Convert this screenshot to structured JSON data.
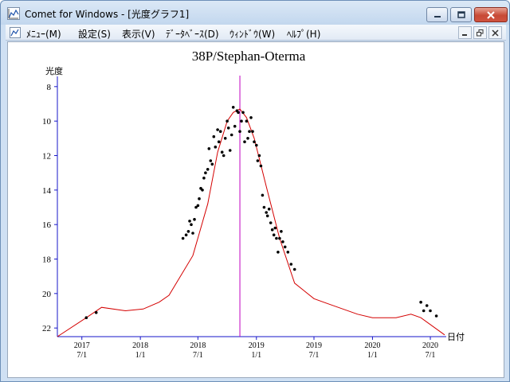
{
  "window": {
    "title": "Comet for Windows - [光度グラフ1]"
  },
  "titlebar_buttons": {
    "minimize_icon": "minimize-icon",
    "maximize_icon": "maximize-icon",
    "close_icon": "close-icon"
  },
  "menu": {
    "items": [
      "ﾒﾆｭｰ(M)",
      "設定(S)",
      "表示(V)",
      "ﾃﾞｰﾀﾍﾞｰｽ(D)",
      "ｳｨﾝﾄﾞｳ(W)",
      "ﾍﾙﾌﾟ(H)"
    ]
  },
  "colors": {
    "axis": "#1515c8",
    "curve": "#d40000",
    "marker": "#c000c0",
    "points": "#000000",
    "close_button": "#c74a36"
  },
  "chart_data": {
    "type": "scatter",
    "title": "38P/Stephan-Oterma",
    "ylabel": "光度",
    "xlabel": "日付",
    "y_inverted": true,
    "ylim": [
      22.5,
      7.5
    ],
    "yticks": [
      8,
      10,
      12,
      14,
      16,
      18,
      20,
      22
    ],
    "xlim": [
      "2017-04-15",
      "2020-08-15"
    ],
    "xticks": [
      {
        "date": "2017-07-01",
        "year": "2017",
        "md": "7/1"
      },
      {
        "date": "2018-01-01",
        "year": "2018",
        "md": "1/1"
      },
      {
        "date": "2018-07-01",
        "year": "2018",
        "md": "7/1"
      },
      {
        "date": "2019-01-01",
        "year": "2019",
        "md": "1/1"
      },
      {
        "date": "2019-07-01",
        "year": "2019",
        "md": "7/1"
      },
      {
        "date": "2020-01-01",
        "year": "2020",
        "md": "1/1"
      },
      {
        "date": "2020-07-01",
        "year": "2020",
        "md": "7/1"
      }
    ],
    "perihelion_marker": "2018-11-10",
    "series": [
      {
        "type": "line",
        "x": [
          "2017-04-15",
          "2017-07-15",
          "2017-09-01",
          "2017-11-15",
          "2018-01-10",
          "2018-03-01",
          "2018-04-01",
          "2018-06-15",
          "2018-08-01",
          "2018-09-01",
          "2018-10-01",
          "2018-10-20",
          "2018-11-10",
          "2018-12-01",
          "2018-12-25",
          "2019-02-01",
          "2019-03-15",
          "2019-05-01",
          "2019-07-01",
          "2019-08-15",
          "2019-11-15",
          "2020-01-01",
          "2020-03-15",
          "2020-05-01",
          "2020-06-01",
          "2020-08-15"
        ],
        "y": [
          22.5,
          21.4,
          20.8,
          21.0,
          20.9,
          20.5,
          20.1,
          17.8,
          14.8,
          11.8,
          10.0,
          9.5,
          9.3,
          9.8,
          11.0,
          13.8,
          16.8,
          19.4,
          20.3,
          20.6,
          21.2,
          21.4,
          21.4,
          21.2,
          21.4,
          22.4
        ]
      },
      {
        "type": "scatter",
        "x": [
          "2017-07-15",
          "2017-08-15",
          "2018-05-15",
          "2018-05-25",
          "2018-06-01",
          "2018-06-05",
          "2018-06-10",
          "2018-06-15",
          "2018-06-20",
          "2018-06-25",
          "2018-07-01",
          "2018-07-05",
          "2018-07-10",
          "2018-07-15",
          "2018-07-20",
          "2018-07-25",
          "2018-08-01",
          "2018-08-05",
          "2018-08-10",
          "2018-08-15",
          "2018-08-20",
          "2018-08-25",
          "2018-09-01",
          "2018-09-05",
          "2018-09-10",
          "2018-09-15",
          "2018-09-20",
          "2018-09-25",
          "2018-10-01",
          "2018-10-05",
          "2018-10-10",
          "2018-10-15",
          "2018-10-20",
          "2018-10-25",
          "2018-11-01",
          "2018-11-05",
          "2018-11-10",
          "2018-11-15",
          "2018-11-20",
          "2018-11-25",
          "2018-12-01",
          "2018-12-05",
          "2018-12-10",
          "2018-12-15",
          "2018-12-20",
          "2018-12-25",
          "2019-01-01",
          "2019-01-05",
          "2019-01-10",
          "2019-01-15",
          "2019-01-20",
          "2019-01-25",
          "2019-02-01",
          "2019-02-05",
          "2019-02-10",
          "2019-02-15",
          "2019-02-20",
          "2019-02-25",
          "2019-03-01",
          "2019-03-05",
          "2019-03-10",
          "2019-03-15",
          "2019-03-20",
          "2019-03-25",
          "2019-04-01",
          "2019-04-10",
          "2019-04-20",
          "2019-05-01",
          "2020-06-01",
          "2020-06-10",
          "2020-06-20",
          "2020-07-01",
          "2020-07-20"
        ],
        "y": [
          21.4,
          21.1,
          16.8,
          16.6,
          16.4,
          15.8,
          16.0,
          16.5,
          15.7,
          15.0,
          14.9,
          14.5,
          13.9,
          14.0,
          13.3,
          13.0,
          12.8,
          11.6,
          12.3,
          12.5,
          10.9,
          11.5,
          10.5,
          11.2,
          10.6,
          11.8,
          12.0,
          11.0,
          10.0,
          10.4,
          11.7,
          10.8,
          9.2,
          10.3,
          9.4,
          9.5,
          10.6,
          10.0,
          9.5,
          11.2,
          10.0,
          11.0,
          10.6,
          9.8,
          10.6,
          11.2,
          11.4,
          12.3,
          12.0,
          12.6,
          14.3,
          15.0,
          15.3,
          15.5,
          15.1,
          15.9,
          16.3,
          16.6,
          16.2,
          16.8,
          17.6,
          16.8,
          16.4,
          17.0,
          17.3,
          17.6,
          18.3,
          18.6,
          20.5,
          21.0,
          20.7,
          21.0,
          21.3
        ]
      }
    ]
  }
}
